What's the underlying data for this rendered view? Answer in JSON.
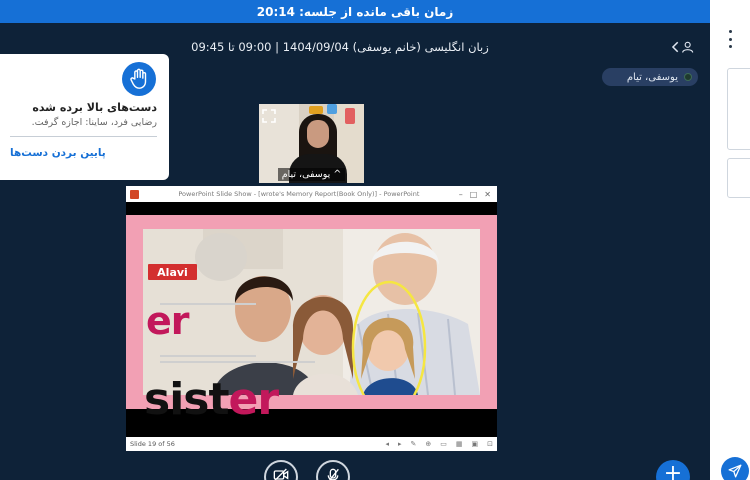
{
  "session": {
    "timer_text": "زمان باقی مانده از جلسه: 20:14",
    "meeting_title": "زبان انگلیسی (خانم یوسفی) 1404/09/04 | 09:00 تا 09:45"
  },
  "presenter": {
    "chip_label": "یوسفی، تیام"
  },
  "raise_hands": {
    "title": "دست‌های بالا برده شده",
    "description": "رضایی فرد، ساینا: اجازه گرفت.",
    "lower_all": "پایین بردن دست‌ها"
  },
  "webcam": {
    "name": "^ یوسفی، تیام"
  },
  "slide_window": {
    "title": "PowerPoint Slide Show - [wrote's Memory Report(Book Only)] - PowerPoint",
    "status": "Slide 19 of 56",
    "slide": {
      "badge": "Alavi",
      "word_top": "er",
      "word_main_black": "sist",
      "word_main_pink": "er"
    }
  },
  "colors": {
    "accent": "#1670d6",
    "background": "#0e2238",
    "slide_pink": "#f2a0b4",
    "highlight_ellipse": "#f5e642"
  },
  "icons": {
    "users": "users-icon",
    "hand": "raised-hand-icon",
    "expand": "expand-icon",
    "kebab": "kebab-menu-icon",
    "send": "send-icon",
    "camera": "camera-off-icon",
    "mic": "mic-off-icon",
    "add": "plus-icon"
  }
}
